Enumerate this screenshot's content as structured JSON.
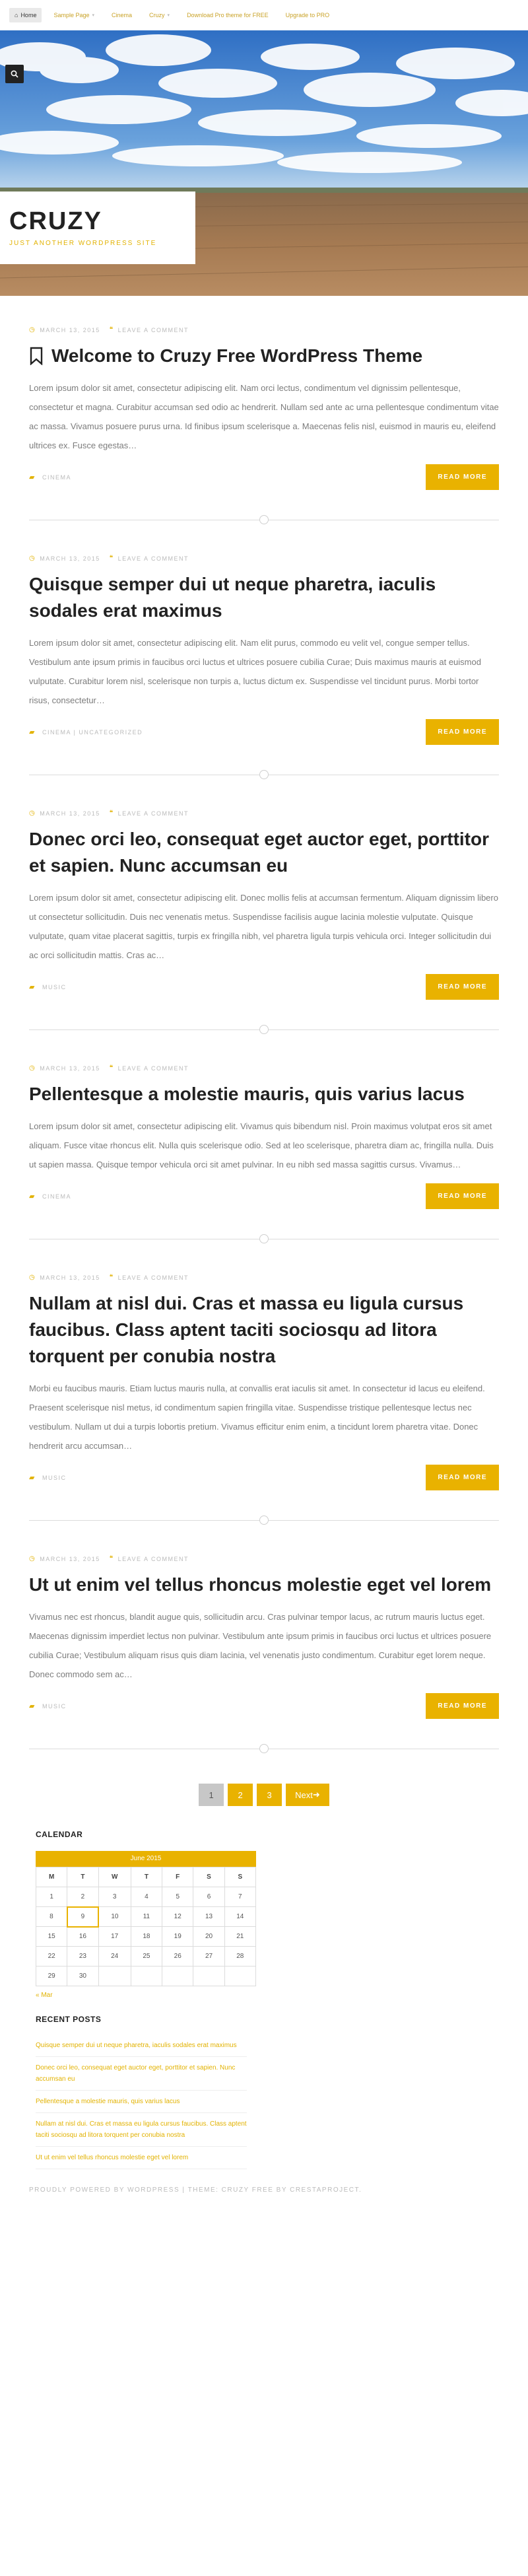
{
  "nav": {
    "items": [
      {
        "label": "Home",
        "icon": "home-icon"
      },
      {
        "label": "Sample Page",
        "has_dropdown": true
      },
      {
        "label": "Cinema"
      },
      {
        "label": "Cruzy",
        "has_dropdown": true
      },
      {
        "label": "Download Pro theme for FREE"
      },
      {
        "label": "Upgrade to PRO"
      }
    ]
  },
  "site": {
    "title": "CRUZY",
    "tagline": "JUST ANOTHER WORDPRESS SITE"
  },
  "posts": [
    {
      "date": "MARCH 13, 2015",
      "comment": "LEAVE A COMMENT",
      "title": "Welcome to Cruzy Free WordPress Theme",
      "sticky": true,
      "excerpt": "Lorem ipsum dolor sit amet, consectetur adipiscing elit. Nam orci lectus, condimentum vel dignissim pellentesque, consectetur et magna. Curabitur accumsan sed odio ac hendrerit. Nullam sed ante ac urna pellentesque condimentum vitae ac massa. Vivamus posuere purus urna. Id finibus ipsum scelerisque a. Maecenas felis nisl, euismod in mauris eu, eleifend ultrices ex. Fusce egestas…",
      "category": "CINEMA",
      "read_more": "READ MORE"
    },
    {
      "date": "MARCH 13, 2015",
      "comment": "LEAVE A COMMENT",
      "title": "Quisque semper dui ut neque pharetra, iaculis sodales erat maximus",
      "sticky": false,
      "excerpt": "Lorem ipsum dolor sit amet, consectetur adipiscing elit. Nam elit purus, commodo eu velit vel, congue semper tellus. Vestibulum ante ipsum primis in faucibus orci luctus et ultrices posuere cubilia Curae; Duis maximus mauris at euismod vulputate. Curabitur lorem nisl, scelerisque non turpis a, luctus dictum ex. Suspendisse vel tincidunt purus. Morbi tortor risus, consectetur…",
      "category": "CINEMA | UNCATEGORIZED",
      "read_more": "READ MORE"
    },
    {
      "date": "MARCH 13, 2015",
      "comment": "LEAVE A COMMENT",
      "title": "Donec orci leo, consequat eget auctor eget, porttitor et sapien. Nunc accumsan eu",
      "sticky": false,
      "excerpt": "Lorem ipsum dolor sit amet, consectetur adipiscing elit. Donec mollis felis at accumsan fermentum. Aliquam dignissim libero ut consectetur sollicitudin. Duis nec venenatis metus. Suspendisse facilisis augue lacinia molestie vulputate. Quisque vulputate, quam vitae placerat sagittis, turpis ex fringilla nibh, vel pharetra ligula turpis vehicula orci. Integer sollicitudin dui ac orci sollicitudin mattis. Cras ac…",
      "category": "MUSIC",
      "read_more": "READ MORE"
    },
    {
      "date": "MARCH 13, 2015",
      "comment": "LEAVE A COMMENT",
      "title": "Pellentesque a molestie mauris, quis varius lacus",
      "sticky": false,
      "excerpt": "Lorem ipsum dolor sit amet, consectetur adipiscing elit. Vivamus quis bibendum nisl. Proin maximus volutpat eros sit amet aliquam. Fusce vitae rhoncus elit. Nulla quis scelerisque odio. Sed at leo scelerisque, pharetra diam ac, fringilla nulla. Duis ut sapien massa. Quisque tempor vehicula orci sit amet pulvinar. In eu nibh sed massa sagittis cursus. Vivamus…",
      "category": "CINEMA",
      "read_more": "READ MORE"
    },
    {
      "date": "MARCH 13, 2015",
      "comment": "LEAVE A COMMENT",
      "title": "Nullam at nisl dui. Cras et massa eu ligula cursus faucibus. Class aptent taciti sociosqu ad litora torquent per conubia nostra",
      "sticky": false,
      "excerpt": "Morbi eu faucibus mauris. Etiam luctus mauris nulla, at convallis erat iaculis sit amet. In consectetur id lacus eu eleifend. Praesent scelerisque nisl metus, id condimentum sapien fringilla vitae. Suspendisse tristique pellentesque lectus nec vestibulum. Nullam ut dui a turpis lobortis pretium. Vivamus efficitur enim enim, a tincidunt lorem pharetra vitae. Donec hendrerit arcu accumsan…",
      "category": "MUSIC",
      "read_more": "READ MORE"
    },
    {
      "date": "MARCH 13, 2015",
      "comment": "LEAVE A COMMENT",
      "title": "Ut ut enim vel tellus rhoncus molestie eget vel lorem",
      "sticky": false,
      "excerpt": "Vivamus nec est rhoncus, blandit augue quis, sollicitudin arcu. Cras pulvinar tempor lacus, ac rutrum mauris luctus eget. Maecenas dignissim imperdiet lectus non pulvinar. Vestibulum ante ipsum primis in faucibus orci luctus et ultrices posuere cubilia Curae; Vestibulum aliquam risus quis diam lacinia, vel venenatis justo condimentum. Curabitur eget lorem neque. Donec commodo sem ac…",
      "category": "MUSIC",
      "read_more": "READ MORE"
    }
  ],
  "pagination": {
    "pages": [
      "1",
      "2",
      "3"
    ],
    "current": "1",
    "next": "Next"
  },
  "calendar": {
    "title": "CALENDAR",
    "caption": "June 2015",
    "days": [
      "M",
      "T",
      "W",
      "T",
      "F",
      "S",
      "S"
    ],
    "weeks": [
      [
        "1",
        "2",
        "3",
        "4",
        "5",
        "6",
        "7"
      ],
      [
        "8",
        "9",
        "10",
        "11",
        "12",
        "13",
        "14"
      ],
      [
        "15",
        "16",
        "17",
        "18",
        "19",
        "20",
        "21"
      ],
      [
        "22",
        "23",
        "24",
        "25",
        "26",
        "27",
        "28"
      ],
      [
        "29",
        "30",
        "",
        "",
        "",
        "",
        ""
      ]
    ],
    "today": "9",
    "prev": "« Mar"
  },
  "recent_posts": {
    "title": "RECENT POSTS",
    "items": [
      "Quisque semper dui ut neque pharetra, iaculis sodales erat maximus",
      "Donec orci leo, consequat eget auctor eget, porttitor et sapien. Nunc accumsan eu",
      "Pellentesque a molestie mauris, quis varius lacus",
      "Nullam at nisl dui. Cras et massa eu ligula cursus faucibus. Class aptent taciti sociosqu ad litora torquent per conubia nostra",
      "Ut ut enim vel tellus rhoncus molestie eget vel lorem"
    ]
  },
  "footer": {
    "text": "PROUDLY POWERED BY WORDPRESS | THEME: CRUZY FREE BY CRESTAPROJECT."
  },
  "colors": {
    "accent": "#e9b200",
    "sky_top": "#2f6fc4",
    "field": "#a57a52"
  }
}
